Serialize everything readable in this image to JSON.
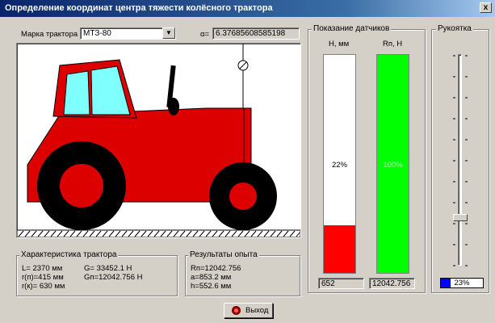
{
  "window": {
    "title": "Определение координат центра тяжести колёсного трактора",
    "close_label": "x"
  },
  "controls": {
    "tractor_label": "Марка трактора",
    "tractor_value": "МТЗ-80",
    "alpha_label": "α=",
    "alpha_value": "6.37685608585198"
  },
  "sensors": {
    "title": "Показание датчиков",
    "h_label": "H, мм",
    "rn_label": "Rп, H",
    "h_percent_text": "22%",
    "h_fill_fraction": 0.22,
    "rn_percent_text": "100%",
    "rn_fill_fraction": 1.0,
    "h_value": "652",
    "rn_value": "12042.756",
    "h_fill_color": "#ff0000",
    "rn_fill_color": "#00ff00"
  },
  "handle": {
    "title": "Рукоятка",
    "percent_text": "23%",
    "progress_fraction": 0.23,
    "progress_color": "#0000ff"
  },
  "characteristics": {
    "title": "Характеристика трактора",
    "L": "L= 2370 мм",
    "G": "G= 33452.1 Н",
    "rp": "r(п)=415 мм",
    "Gn": "Gп=12042.756 Н",
    "rk": "r(к)= 630 мм"
  },
  "results": {
    "title": "Результаты опыта",
    "Rn": "Rп=12042.756",
    "a": "a=853.2 мм",
    "h": "h=552.6 мм"
  },
  "exit_button": {
    "label": "Выход",
    "icon": "stop-icon"
  },
  "colors": {
    "tractor_body": "#dc0000",
    "cab_glass": "#80ffff",
    "wheel": "#000000",
    "titlebar": "#0a246a"
  }
}
